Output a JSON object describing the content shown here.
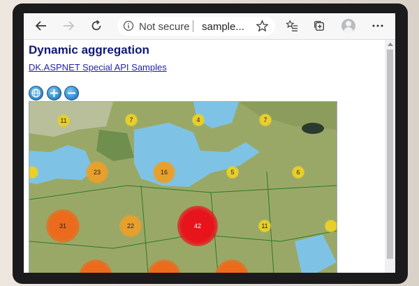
{
  "browser": {
    "address": {
      "security_label": "Not secure",
      "url": "sample..."
    }
  },
  "icons": {
    "back": "back-arrow-icon",
    "forward": "forward-arrow-icon",
    "refresh": "refresh-icon",
    "info": "info-icon",
    "favorite": "star-icon",
    "favorites_list": "favorites-list-icon",
    "collections": "collections-icon",
    "profile": "avatar",
    "menu": "more-icon"
  },
  "page": {
    "title": "Dynamic aggregation",
    "link": "DK.ASPNET Special API Samples",
    "tools": [
      "globe-icon",
      "zoom-in-icon",
      "zoom-out-icon"
    ]
  },
  "map": {
    "clusters": [
      {
        "label": "11",
        "tier": "small"
      },
      {
        "label": "7",
        "tier": "small"
      },
      {
        "label": "4",
        "tier": "small"
      },
      {
        "label": "7",
        "tier": "small"
      },
      {
        "label": "",
        "tier": "small"
      },
      {
        "label": "23",
        "tier": "medium"
      },
      {
        "label": "16",
        "tier": "medium"
      },
      {
        "label": "5",
        "tier": "small"
      },
      {
        "label": "6",
        "tier": "small"
      },
      {
        "label": "31",
        "tier": "large"
      },
      {
        "label": "22",
        "tier": "medium"
      },
      {
        "label": "42",
        "tier": "largest"
      },
      {
        "label": "11",
        "tier": "small"
      },
      {
        "label": "",
        "tier": "small"
      },
      {
        "label": "",
        "tier": "large"
      },
      {
        "label": "",
        "tier": "large"
      },
      {
        "label": "",
        "tier": "large"
      }
    ],
    "colors": {
      "small": "#e8cf2a",
      "medium": "#e8a02c",
      "large": "#ec6a1c",
      "largest": "#e8141c",
      "water": "#7ec3e6",
      "land": "#9aa867"
    }
  }
}
